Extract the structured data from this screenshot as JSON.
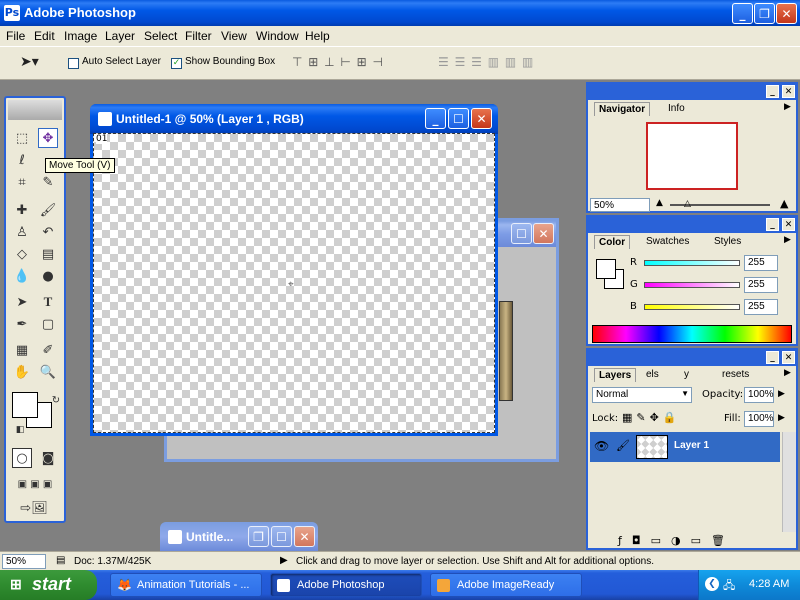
{
  "app_title": "Adobe Photoshop",
  "menu": [
    "File",
    "Edit",
    "Image",
    "Layer",
    "Select",
    "Filter",
    "View",
    "Window",
    "Help"
  ],
  "options": {
    "auto_select_label": "Auto Select Layer",
    "auto_select_checked": false,
    "bounding_box_label": "Show Bounding Box",
    "bounding_box_checked": true
  },
  "tooltip": "Move Tool (V)",
  "document": {
    "title": "Untitled-1 @ 50% (Layer 1 , RGB)",
    "ruler_label": "01"
  },
  "minimized_doc_title": "Untitle...",
  "navigator": {
    "tab_active": "Navigator",
    "tab_other": "Info",
    "zoom": "50%"
  },
  "color_panel": {
    "tabs": [
      "Color",
      "Swatches",
      "Styles"
    ],
    "r_label": "R",
    "g_label": "G",
    "b_label": "B",
    "r": "255",
    "g": "255",
    "b": "255"
  },
  "layers_panel": {
    "tabs": [
      "Layers",
      "els",
      "y",
      "resets"
    ],
    "blend_mode": "Normal",
    "opacity_label": "Opacity:",
    "opacity": "100%",
    "lock_label": "Lock:",
    "fill_label": "Fill:",
    "fill": "100%",
    "layer_name": "Layer 1"
  },
  "status": {
    "zoom": "50%",
    "doc_info": "Doc: 1.37M/425K",
    "hint": "Click and drag to move layer or selection.  Use Shift and Alt for additional options."
  },
  "taskbar": {
    "start_label": "start",
    "items": [
      "Animation Tutorials - ...",
      "Adobe Photoshop",
      "Adobe ImageReady"
    ],
    "clock": "4:28 AM"
  },
  "colors": {
    "xp_blue": "#0058e6",
    "panel_bg": "#ece9d8",
    "layer_selected": "#316ac5",
    "navigator_red": "#cc2222"
  }
}
